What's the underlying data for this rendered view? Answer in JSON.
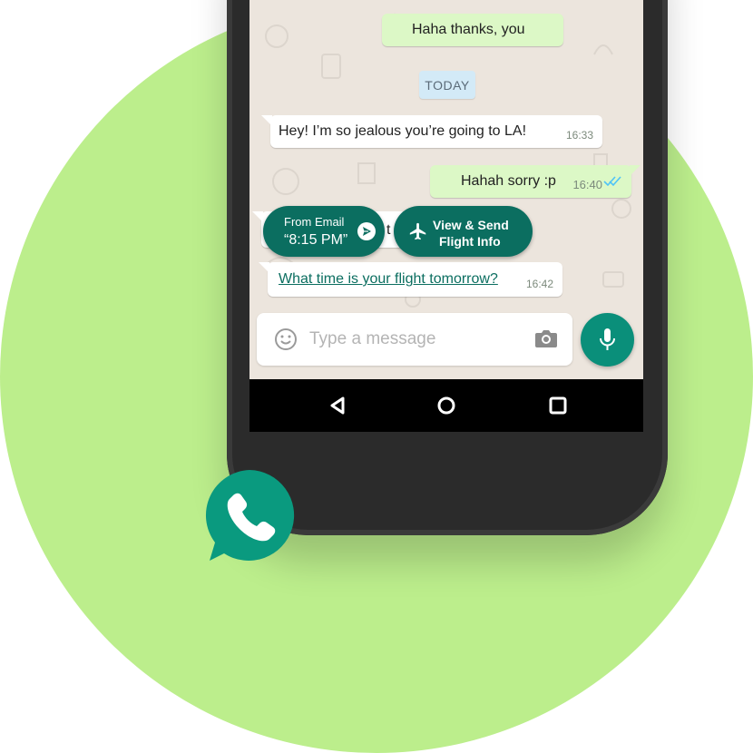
{
  "colors": {
    "background_circle": "#bcee8c",
    "chip": "#0b6e60",
    "mic": "#0a8f7a",
    "outgoing_bubble": "#dcf8c6"
  },
  "messages": [
    {
      "direction": "out",
      "text": "Haha thanks, you",
      "time": ""
    },
    {
      "direction": "in",
      "text": "Hey! I’m so jealous you’re going to LA!",
      "time": "16:33"
    },
    {
      "direction": "out",
      "text": "Hahah sorry :p",
      "time": "16:40",
      "status": "read"
    },
    {
      "direction": "in",
      "text": "t",
      "time": ""
    },
    {
      "direction": "in",
      "text": "What time is your flight tomorrow?",
      "time": "16:42",
      "link": true
    }
  ],
  "date_separator": "TODAY",
  "smart_chips": [
    {
      "line1": "From Email",
      "line2": "“8:15 PM”",
      "icon": "send-icon"
    },
    {
      "line1": "View & Send",
      "line2": "Flight Info",
      "icon": "airplane-icon"
    }
  ],
  "composer": {
    "placeholder": "Type a message",
    "value": ""
  },
  "icons": [
    "emoji-icon",
    "camera-icon",
    "mic-icon",
    "back-icon",
    "home-icon",
    "recents-icon",
    "whatsapp-logo"
  ]
}
